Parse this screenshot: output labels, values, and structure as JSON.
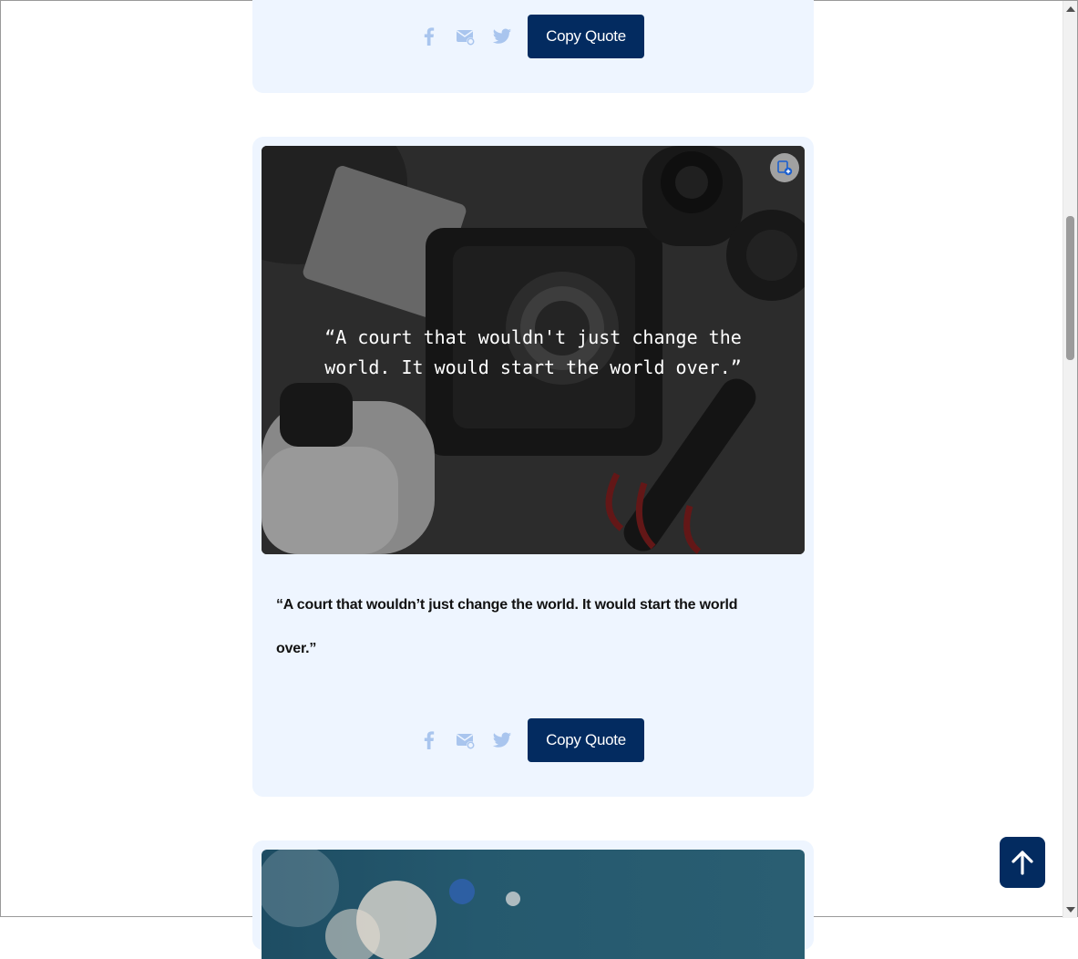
{
  "cards": [
    {
      "share": {
        "facebook_icon": "facebook-icon",
        "email_icon": "email-icon",
        "twitter_icon": "twitter-icon"
      },
      "copy_label": "Copy Quote"
    },
    {
      "overlay_quote": "“A court that wouldn't just change the world. It would start the world over.”",
      "body_quote": "“A court that wouldn’t just change the world. It would start the world over.”",
      "favorite_icon": "bookmark-add-icon",
      "share": {
        "facebook_icon": "facebook-icon",
        "email_icon": "email-icon",
        "twitter_icon": "twitter-icon"
      },
      "copy_label": "Copy Quote"
    }
  ],
  "back_to_top_icon": "arrow-up-icon",
  "colors": {
    "card_bg": "#eef5ff",
    "button_bg": "#032b60",
    "share_icon": "#a9c5ee"
  }
}
